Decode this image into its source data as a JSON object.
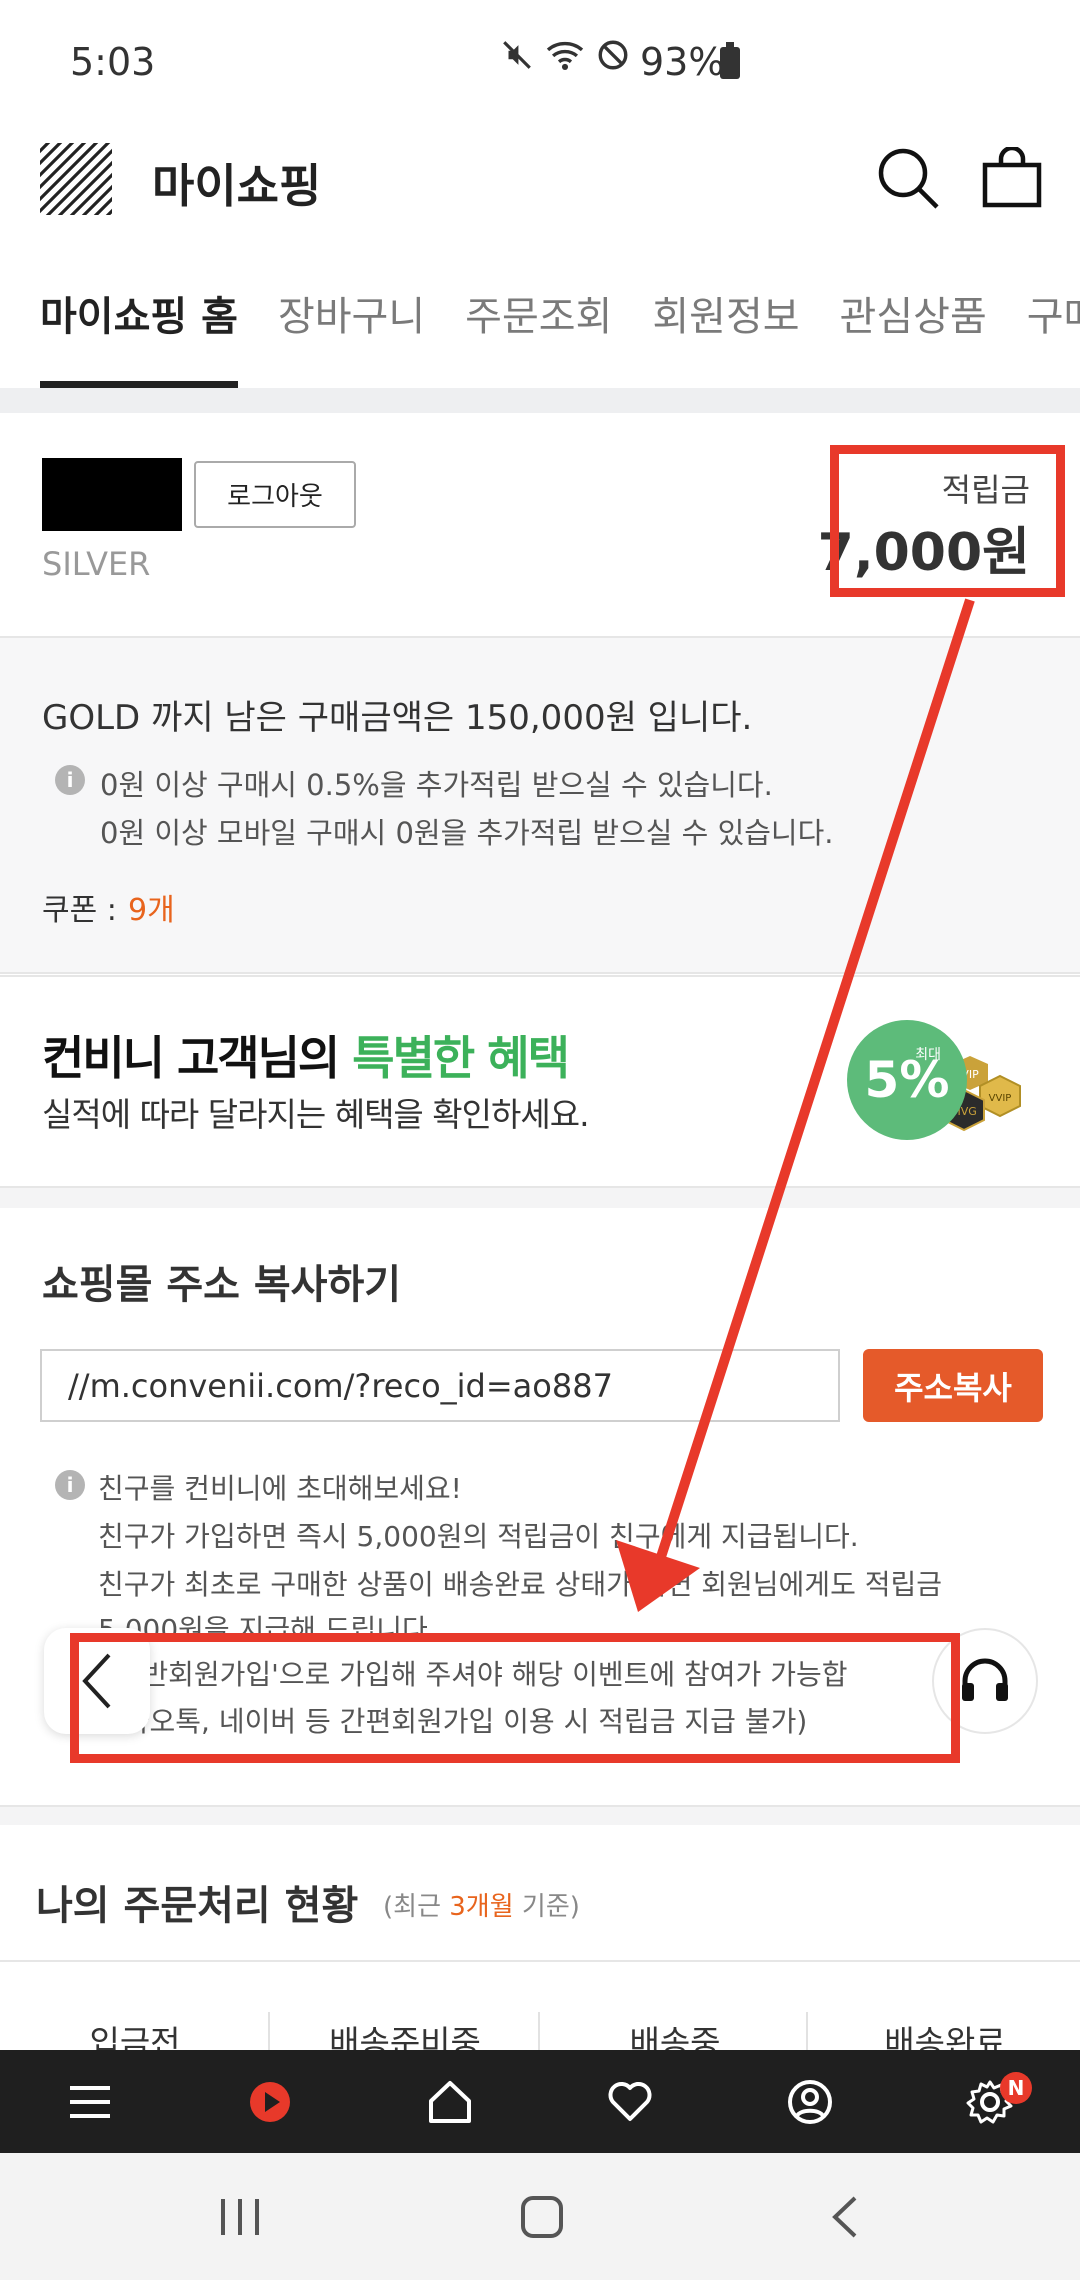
{
  "status_bar": {
    "time": "5:03",
    "battery": "93%"
  },
  "header": {
    "title": "마이쇼핑"
  },
  "tabs": [
    {
      "label": "마이쇼핑 홈"
    },
    {
      "label": "장바구니"
    },
    {
      "label": "주문조회"
    },
    {
      "label": "회원정보"
    },
    {
      "label": "관심상품"
    },
    {
      "label": "구매"
    }
  ],
  "member": {
    "logout_label": "로그아웃",
    "grade": "SILVER",
    "points_label": "적립금",
    "points_value": "7,000원"
  },
  "gold_info": {
    "message": "GOLD 까지 남은 구매금액은 150,000원 입니다.",
    "notes": [
      "0원 이상 구매시 0.5%을 추가적립 받으실 수 있습니다.",
      "0원 이상 모바일 구매시 0원을 추가적립 받으실 수 있습니다."
    ],
    "coupon_label": "쿠폰 :",
    "coupon_count": "9개"
  },
  "banner": {
    "title_a": "컨비니 고객님의 ",
    "title_b": "특별한 혜택",
    "subtitle": "실적에 따라 달라지는 혜택을 확인하세요.",
    "badge_small": "최대",
    "badge_big": "5%",
    "badge_vip": "VIP",
    "badge_mvg": "MVG",
    "badge_vvip": "VVIP"
  },
  "address": {
    "title": "쇼핑몰 주소 복사하기",
    "url": "//m.convenii.com/?reco_id=ao887",
    "copy_label": "주소복사",
    "notes": [
      "친구를 컨비니에 초대해보세요!",
      "친구가 가입하면 즉시 5,000원의 적립금이 친구에게 지급됩니다.",
      "친구가 최초로 구매한 상품이 배송완료 상태가 되면 회원님에게도 적립금",
      "5,000원을 지급해 드립니다.",
      "('일반회원가입'으로 가입해 주셔야 해당 이벤트에 참여가 가능합",
      "카카오톡, 네이버 등 간편회원가입 이용 시 적립금 지급 불가)"
    ]
  },
  "orders": {
    "title": "나의 주문처리 현황",
    "sub_pre": "(최근 ",
    "sub_highlight": "3개월",
    "sub_post": " 기준)",
    "columns": [
      "입금전",
      "배송준비중",
      "배송중",
      "배송완료"
    ]
  },
  "bottom_nav": {
    "badge": "N"
  },
  "colors": {
    "accent": "#e55a2a",
    "highlight": "#e8392a",
    "green": "#3cb15a"
  }
}
